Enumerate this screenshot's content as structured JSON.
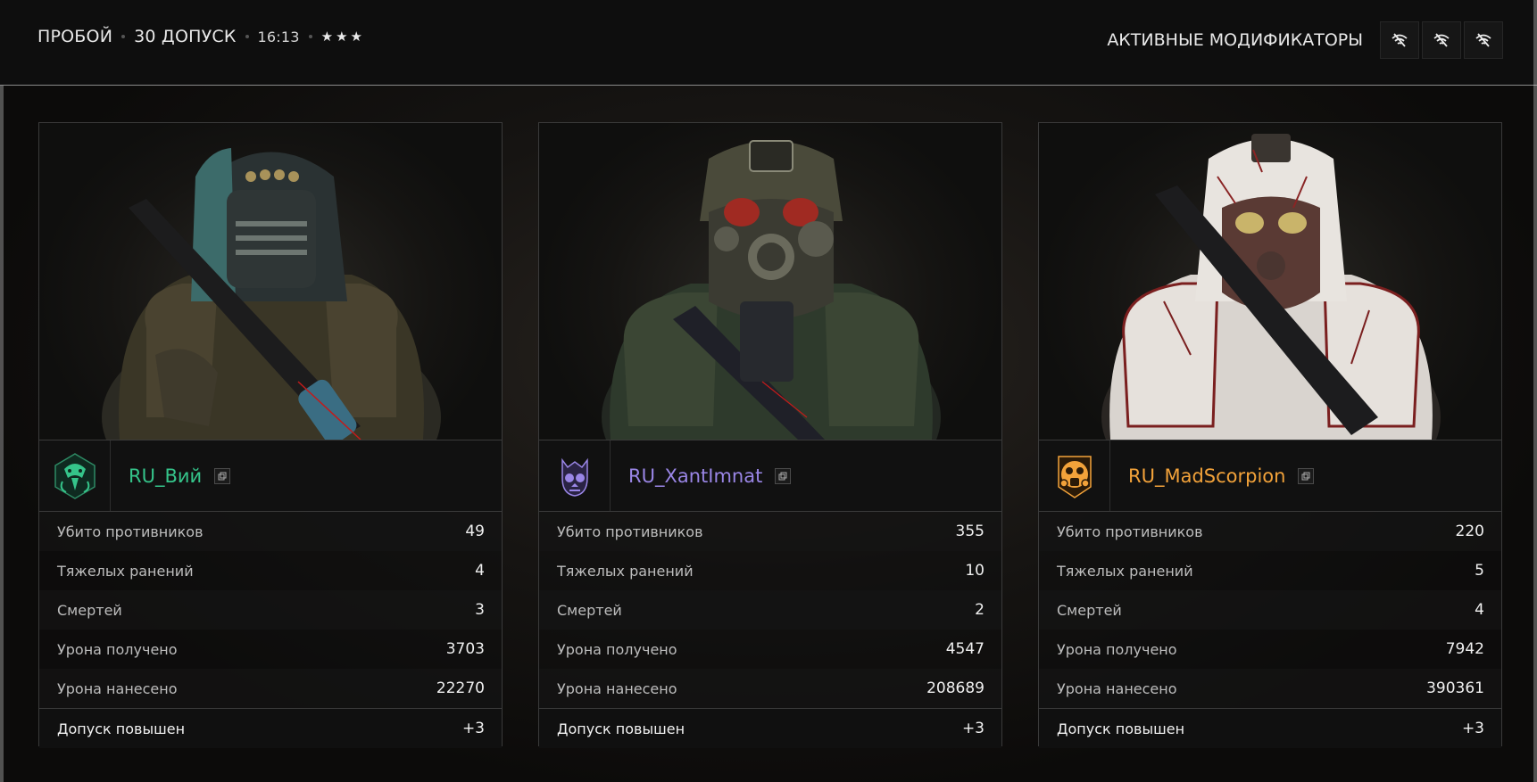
{
  "header": {
    "mode": "ПРОБОЙ",
    "clearance": "30 ДОПУСК",
    "time": "16:13",
    "stars": "★★★",
    "modifiers_label": "АКТИВНЫЕ МОДИФИКАТОРЫ",
    "modifier_icons": [
      "no-signal-icon",
      "no-signal-icon",
      "no-signal-icon"
    ]
  },
  "colors": {
    "player1": "#35c48a",
    "player2": "#9a86e6",
    "player3": "#f2a23a"
  },
  "players": [
    {
      "name": "RU_Вий",
      "emblem": "snake-emblem-icon",
      "stats": [
        {
          "label": "Убито противников",
          "value": "49"
        },
        {
          "label": "Тяжелых ранений",
          "value": "4"
        },
        {
          "label": "Смертей",
          "value": "3"
        },
        {
          "label": "Урона получено",
          "value": "3703"
        },
        {
          "label": "Урона нанесено",
          "value": "22270"
        }
      ],
      "clearance": {
        "label": "Допуск повышен",
        "value": "+3"
      }
    },
    {
      "name": "RU_XantImnat",
      "emblem": "skull-emblem-icon",
      "stats": [
        {
          "label": "Убито противников",
          "value": "355"
        },
        {
          "label": "Тяжелых ранений",
          "value": "10"
        },
        {
          "label": "Смертей",
          "value": "2"
        },
        {
          "label": "Урона получено",
          "value": "4547"
        },
        {
          "label": "Урона нанесено",
          "value": "208689"
        }
      ],
      "clearance": {
        "label": "Допуск повышен",
        "value": "+3"
      }
    },
    {
      "name": "RU_MadScorpion",
      "emblem": "gasmask-emblem-icon",
      "stats": [
        {
          "label": "Убито противников",
          "value": "220"
        },
        {
          "label": "Тяжелых ранений",
          "value": "5"
        },
        {
          "label": "Смертей",
          "value": "4"
        },
        {
          "label": "Урона получено",
          "value": "7942"
        },
        {
          "label": "Урона нанесено",
          "value": "390361"
        }
      ],
      "clearance": {
        "label": "Допуск повышен",
        "value": "+3"
      }
    }
  ]
}
